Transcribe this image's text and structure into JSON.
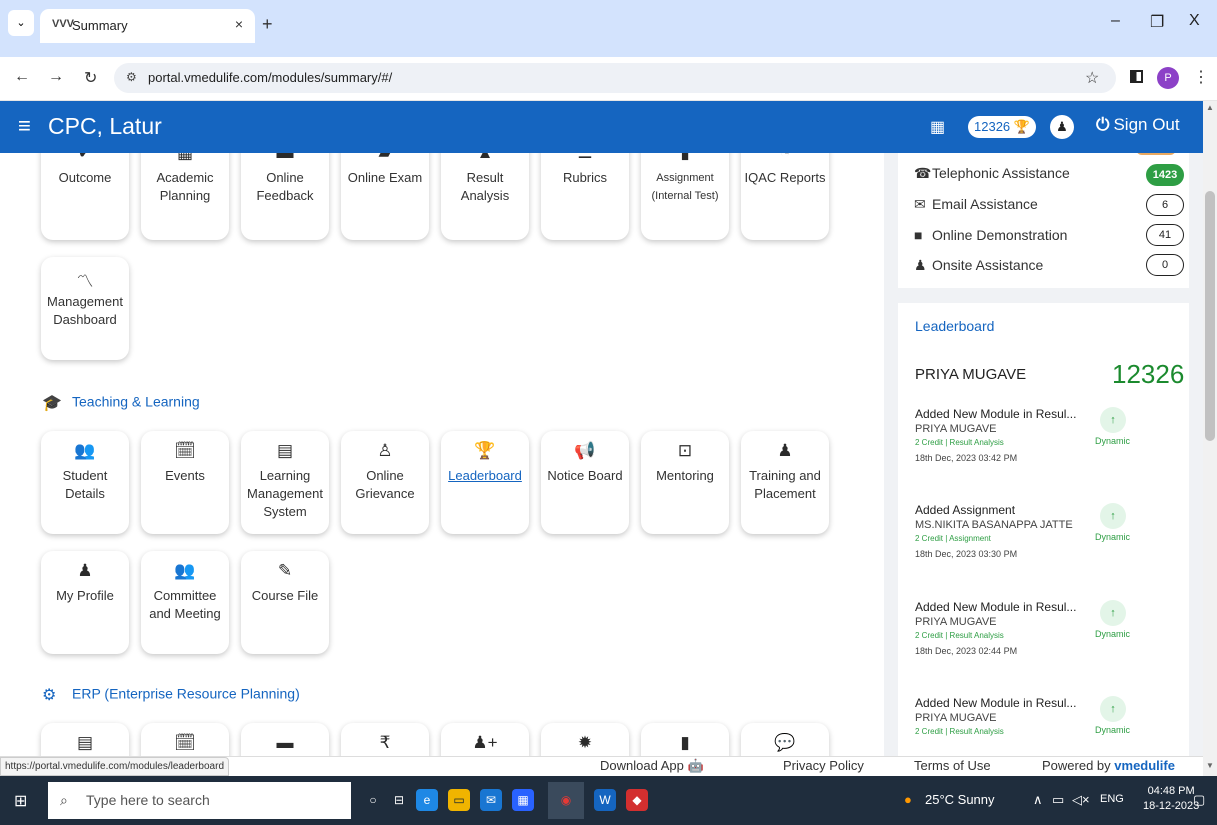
{
  "browser": {
    "tab_favicon": "VVV",
    "tab_title": "Summary",
    "tab_close": "×",
    "new_tab": "+",
    "url_site_icon": "⚙",
    "url": "portal.vmedulife.com/modules/summary/#/",
    "profile_initial": "P",
    "win_min": "–",
    "win_max": "❐",
    "win_close": "X"
  },
  "header": {
    "menu_icon": "≡",
    "org_name": "CPC, Latur",
    "points": "12326",
    "sign_out": "Sign Out"
  },
  "modules_row1": [
    {
      "label": "Outcome",
      "icon": "check-icon"
    },
    {
      "label": "Academic Planning",
      "icon": "calendar-icon"
    },
    {
      "label": "Online Feedback",
      "icon": "comment-icon"
    },
    {
      "label": "Online Exam",
      "icon": "folder-icon"
    },
    {
      "label": "Result Analysis",
      "icon": "chart-icon"
    },
    {
      "label": "Rubrics",
      "icon": "list-icon"
    },
    {
      "label": "Assignment (Internal Test)",
      "icon": "document-icon"
    },
    {
      "label": "IQAC Reports",
      "icon": "pie-chart-icon"
    }
  ],
  "management_dashboard": {
    "label": "Management Dashboard",
    "icon": "line-chart-icon"
  },
  "teaching_section": {
    "title": "Teaching & Learning",
    "modules": [
      {
        "label": "Student Details",
        "icon": "users-icon"
      },
      {
        "label": "Events",
        "icon": "calendar-icon"
      },
      {
        "label": "Learning Management System",
        "icon": "book-icon"
      },
      {
        "label": "Online Grievance",
        "icon": "person-icon"
      },
      {
        "label": "Leaderboard",
        "icon": "trophy-icon"
      },
      {
        "label": "Notice Board",
        "icon": "megaphone-icon"
      },
      {
        "label": "Mentoring",
        "icon": "board-icon"
      },
      {
        "label": "Training and Placement",
        "icon": "user-tie-icon"
      },
      {
        "label": "My Profile",
        "icon": "user-icon"
      },
      {
        "label": "Committee and Meeting",
        "icon": "users-icon"
      },
      {
        "label": "Course File",
        "icon": "edit-file-icon"
      }
    ]
  },
  "erp_section": {
    "title": "ERP (Enterprise Resource Planning)"
  },
  "assistance": {
    "items": [
      {
        "label": "Telephonic Assistance",
        "count": "1423",
        "icon": "phone-icon"
      },
      {
        "label": "Email Assistance",
        "count": "6",
        "icon": "envelope-icon"
      },
      {
        "label": "Online Demonstration",
        "count": "41",
        "icon": "video-icon"
      },
      {
        "label": "Onsite Assistance",
        "count": "0",
        "icon": "user-check-icon"
      }
    ]
  },
  "leaderboard": {
    "title": "Leaderboard",
    "top_name": "PRIYA MUGAVE",
    "top_score": "12326",
    "entries": [
      {
        "title": "Added New Module in Resul...",
        "name": "PRIYA MUGAVE",
        "credit": "2 Credit | Result Analysis",
        "date": "18th Dec, 2023 03:42 PM",
        "tag": "Dynamic"
      },
      {
        "title": "Added Assignment",
        "name": "MS.NIKITA BASANAPPA JATTE",
        "credit": "2 Credit | Assignment",
        "date": "18th Dec, 2023 03:30 PM",
        "tag": "Dynamic"
      },
      {
        "title": "Added New Module in Resul...",
        "name": "PRIYA MUGAVE",
        "credit": "2 Credit | Result Analysis",
        "date": "18th Dec, 2023 02:44 PM",
        "tag": "Dynamic"
      },
      {
        "title": "Added New Module in Resul...",
        "name": "PRIYA MUGAVE",
        "credit": "2 Credit | Result Analysis",
        "date": "",
        "tag": "Dynamic"
      }
    ]
  },
  "status": {
    "hover_url": "https://portal.vmedulife.com/modules/leaderboard",
    "download_app": "Download App",
    "privacy": "Privacy Policy",
    "terms": "Terms of Use",
    "powered_by": "Powered by",
    "brand": "vmedulife"
  },
  "taskbar": {
    "search_placeholder": "Type here to search",
    "weather": "25°C  Sunny",
    "lang": "ENG",
    "time": "04:48 PM",
    "date": "18-12-2023"
  },
  "colors": {
    "brand_blue": "#1565c0",
    "accent_green": "#2e9e44",
    "tab_strip": "#d3e3fd"
  }
}
